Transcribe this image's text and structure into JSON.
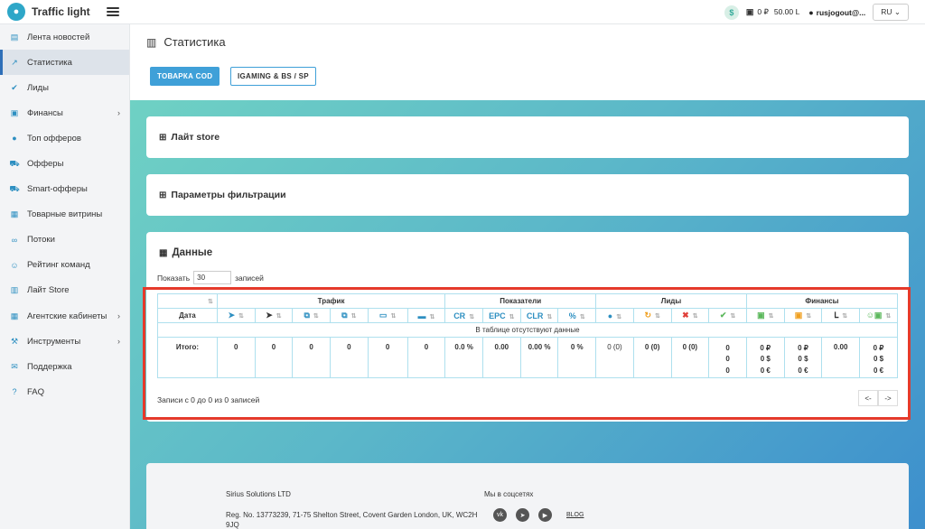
{
  "app": {
    "title": "Traffic light"
  },
  "topbar": {
    "balance_rub": "0 ₽",
    "balance_lira": "50.00 Ⅼ",
    "user": "rusjogout@...",
    "lang": "RU"
  },
  "sidebar": {
    "items": [
      {
        "label": "Лента новостей",
        "icon": "newspaper-icon"
      },
      {
        "label": "Статистика",
        "icon": "chart-line-icon",
        "active": true
      },
      {
        "label": "Лиды",
        "icon": "check-circle-icon"
      },
      {
        "label": "Финансы",
        "icon": "money-icon",
        "chevron": true
      },
      {
        "label": "Топ офферов",
        "icon": "bomb-icon"
      },
      {
        "label": "Офферы",
        "icon": "cart-icon"
      },
      {
        "label": "Smart-офферы",
        "icon": "cart-icon"
      },
      {
        "label": "Товарные витрины",
        "icon": "film-icon"
      },
      {
        "label": "Потоки",
        "icon": "link-icon"
      },
      {
        "label": "Рейтинг команд",
        "icon": "users-icon"
      },
      {
        "label": "Лайт Store",
        "icon": "store-icon"
      },
      {
        "label": "Агентские кабинеты",
        "icon": "grid-icon",
        "chevron": true
      },
      {
        "label": "Инструменты",
        "icon": "wrench-icon",
        "chevron": true
      },
      {
        "label": "Поддержка",
        "icon": "support-icon"
      },
      {
        "label": "FAQ",
        "icon": "question-icon"
      }
    ]
  },
  "page": {
    "title": "Статистика",
    "tab_cod": "ТОВАРКА COD",
    "tab_igaming": "IGAMING & BS / SP"
  },
  "cards": {
    "lite_store": "Лайт store",
    "filters": "Параметры фильтрации",
    "data": "Данные"
  },
  "data_table": {
    "show_label": "Показать",
    "show_value": "30",
    "records_label": "записей",
    "groups": [
      "Трафик",
      "Показатели",
      "Лиды",
      "Финансы"
    ],
    "date_header": "Дата",
    "metrics": [
      "CR",
      "EPC",
      "CLR",
      "%"
    ],
    "empty_text": "В таблице отсутствуют данные",
    "total_label": "Итого:",
    "totals": {
      "traffic": [
        "0",
        "0",
        "0",
        "0",
        "0",
        "0"
      ],
      "metrics": [
        "0.0 %",
        "0.00",
        "0.00 %",
        "0 %"
      ],
      "leads": [
        "0 (0)",
        "0 (0)",
        "0 (0)",
        "0\n0\n0"
      ],
      "finance": [
        "0 ₽\n0 $\n0 €",
        "0 ₽\n0 $\n0 €",
        "0.00",
        "0 ₽\n0 $\n0 €"
      ]
    },
    "records_info": "Записи с 0 до 0 из 0 записей",
    "prev": "<-",
    "next": "->"
  },
  "footer": {
    "company": "Sirius Solutions LTD",
    "address": "Reg. No. 13773239, 71-75 Shelton Street, Covent Garden London, UK, WC2H 9JQ",
    "social_title": "Мы в соцсетях",
    "blog": "BLOG"
  }
}
